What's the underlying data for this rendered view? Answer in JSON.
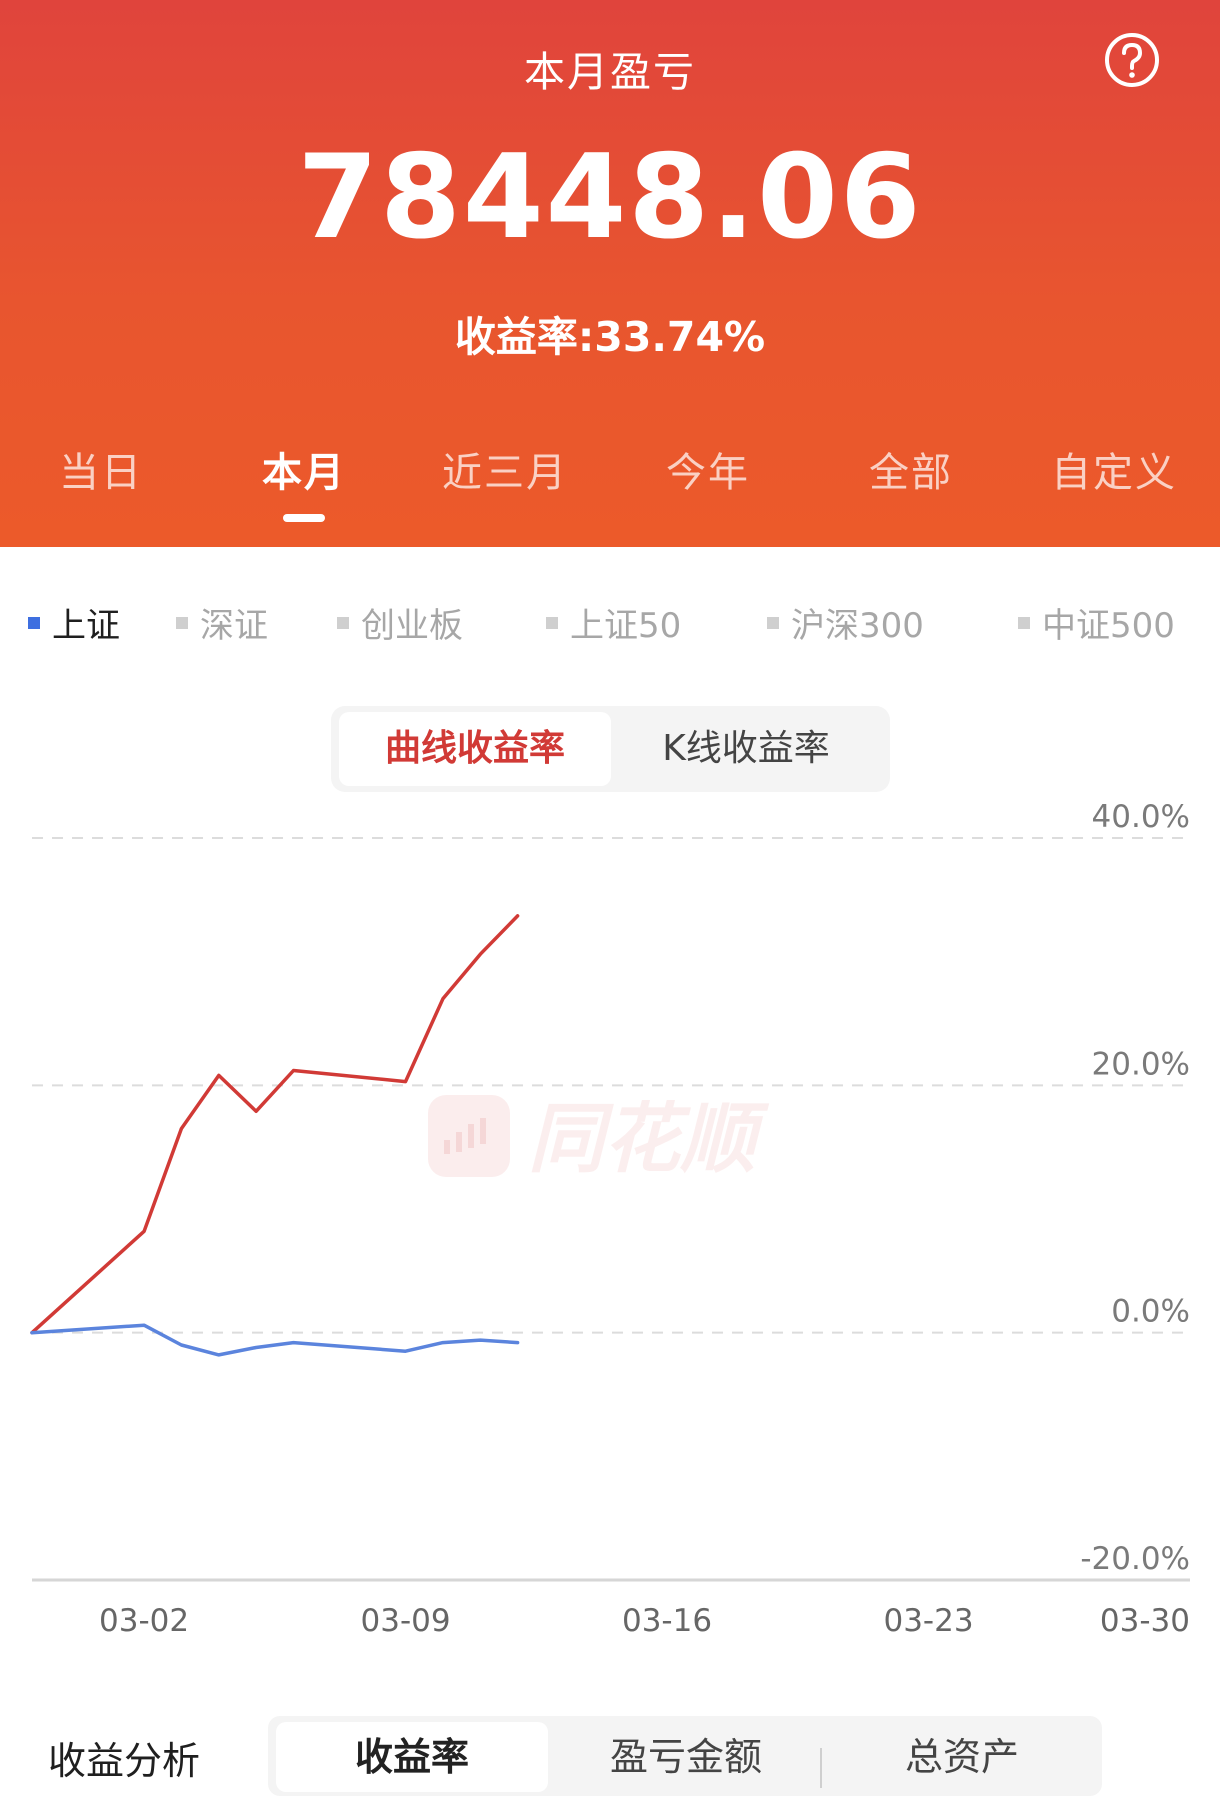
{
  "header": {
    "title": "本月盈亏",
    "amount": "78448.06",
    "rate_label": "收益率:33.74%"
  },
  "period_tabs": [
    {
      "label": "当日",
      "active": false
    },
    {
      "label": "本月",
      "active": true
    },
    {
      "label": "近三月",
      "active": false
    },
    {
      "label": "今年",
      "active": false
    },
    {
      "label": "全部",
      "active": false
    },
    {
      "label": "自定义",
      "active": false
    }
  ],
  "index_tabs": [
    {
      "label": "上证",
      "active": true
    },
    {
      "label": "深证",
      "active": false
    },
    {
      "label": "创业板",
      "active": false
    },
    {
      "label": "上证50",
      "active": false
    },
    {
      "label": "沪深300",
      "active": false
    },
    {
      "label": "中证500",
      "active": false
    }
  ],
  "chart_mode": {
    "options": [
      "曲线收益率",
      "K线收益率"
    ],
    "selected": "曲线收益率"
  },
  "watermark": "同花顺",
  "colors": {
    "header_top": "#e0443c",
    "header_bottom": "#ec5a2a",
    "portfolio_line": "#d13a36",
    "index_line": "#5b84dd"
  },
  "chart_data": {
    "type": "line",
    "x_tick_labels": [
      "03-02",
      "03-09",
      "03-16",
      "03-23",
      "03-30"
    ],
    "y_tick_labels": [
      "40.0%",
      "20.0%",
      "0.0%",
      "-20.0%"
    ],
    "ylim": [
      -20,
      40
    ],
    "xlim": [
      "02-27",
      "03-30"
    ],
    "grid": true,
    "series": [
      {
        "color": "#d13a36",
        "x": [
          "02-27",
          "03-02",
          "03-03",
          "03-04",
          "03-05",
          "03-06",
          "03-09",
          "03-10",
          "03-11",
          "03-12"
        ],
        "values": [
          0.0,
          8.2,
          16.5,
          20.8,
          17.9,
          21.2,
          20.3,
          27.0,
          30.6,
          33.7
        ]
      },
      {
        "color": "#5b84dd",
        "x": [
          "02-27",
          "03-02",
          "03-03",
          "03-04",
          "03-05",
          "03-06",
          "03-09",
          "03-10",
          "03-11",
          "03-12"
        ],
        "values": [
          0.0,
          0.6,
          -1.0,
          -1.8,
          -1.2,
          -0.8,
          -1.5,
          -0.8,
          -0.6,
          -0.8
        ]
      }
    ]
  },
  "bottom": {
    "label": "收益分析",
    "tabs": [
      "收益率",
      "盈亏金额",
      "总资产"
    ],
    "selected": "收益率"
  }
}
